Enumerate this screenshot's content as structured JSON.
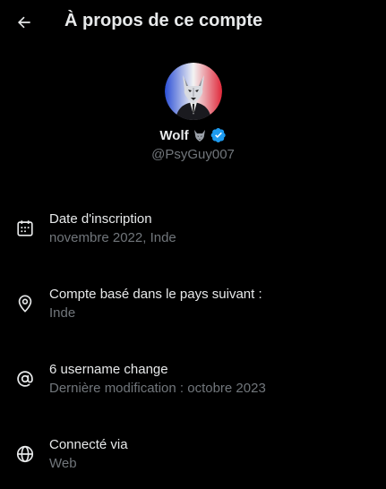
{
  "header": {
    "title": "À propos de ce compte",
    "back_icon": "arrow-left-icon"
  },
  "profile": {
    "display_name": "Wolf",
    "name_emoji": "wolf-emoji-icon",
    "verified_icon": "verified-badge-icon",
    "verified_color": "#1d9bf0",
    "handle": "@PsyGuy007"
  },
  "items": [
    {
      "icon": "calendar-icon",
      "title": "Date d'inscription",
      "subtitle": "novembre 2022, Inde"
    },
    {
      "icon": "location-pin-icon",
      "title": "Compte basé dans le pays suivant :",
      "subtitle": "Inde"
    },
    {
      "icon": "at-sign-icon",
      "title": "6 username change",
      "subtitle": "Dernière modification : octobre 2023"
    },
    {
      "icon": "globe-icon",
      "title": "Connecté via",
      "subtitle": "Web"
    }
  ],
  "colors": {
    "background": "#000000",
    "primary_text": "#e7e9ea",
    "secondary_text": "#71767b",
    "accent": "#1d9bf0"
  }
}
